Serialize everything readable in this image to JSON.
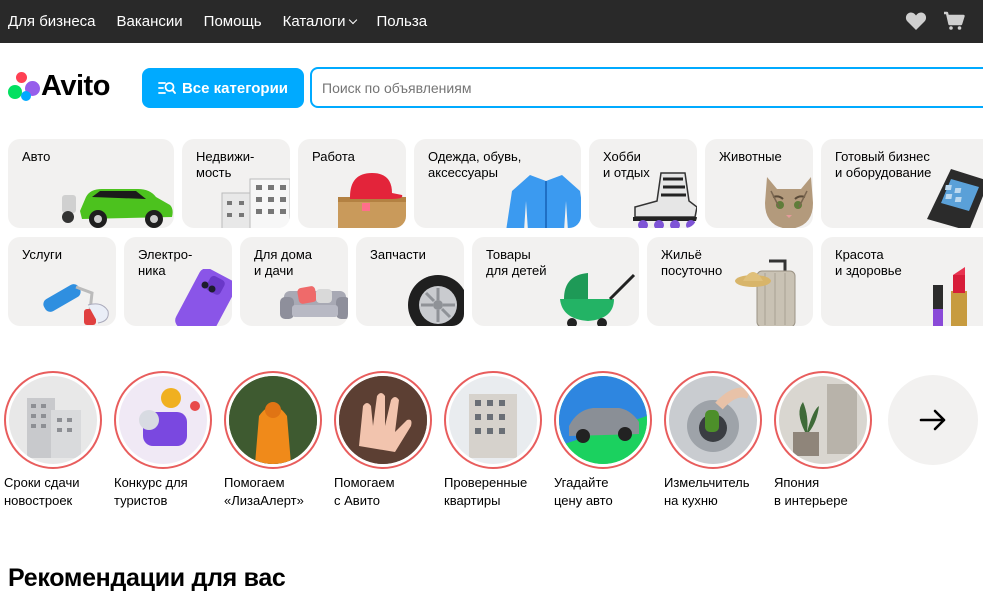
{
  "topnav": {
    "items": [
      "Для бизнеса",
      "Вакансии",
      "Помощь",
      "Каталоги",
      "Польза"
    ]
  },
  "logo": {
    "text": "Avito"
  },
  "categories_button": {
    "label": "Все категории"
  },
  "search": {
    "placeholder": "Поиск по объявлениям"
  },
  "categories": [
    {
      "label": "Авто"
    },
    {
      "label": "Недвижи-\nмость"
    },
    {
      "label": "Работа"
    },
    {
      "label": "Одежда, обувь,\nаксессуары"
    },
    {
      "label": "Хобби\nи отдых"
    },
    {
      "label": "Животные"
    },
    {
      "label": "Готовый бизнес\nи оборудование"
    },
    {
      "label": "Услуги"
    },
    {
      "label": "Электро-\nника"
    },
    {
      "label": "Для дома\nи дачи"
    },
    {
      "label": "Запчасти"
    },
    {
      "label": "Товары\nдля детей"
    },
    {
      "label": "Жильё\nпосуточно"
    },
    {
      "label": "Красота\nи здоровье"
    }
  ],
  "stories": [
    {
      "caption": "Сроки сдачи\nновостроек"
    },
    {
      "caption": "Конкурс для\nтуристов"
    },
    {
      "caption": "Помогаем\n«ЛизаАлерт»"
    },
    {
      "caption": "Помогаем\nс Авито"
    },
    {
      "caption": "Проверенные\nквартиры"
    },
    {
      "caption": "Угадайте\nцену авто"
    },
    {
      "caption": "Измельчитель\nна кухню"
    },
    {
      "caption": "Япония\nв интерьере"
    }
  ],
  "recommendations": {
    "title": "Рекомендации для вас"
  },
  "colors": {
    "accent": "#00aaff",
    "topbar": "#292929",
    "tile": "#f2f1f0",
    "story_ring": "#e85d5d"
  }
}
